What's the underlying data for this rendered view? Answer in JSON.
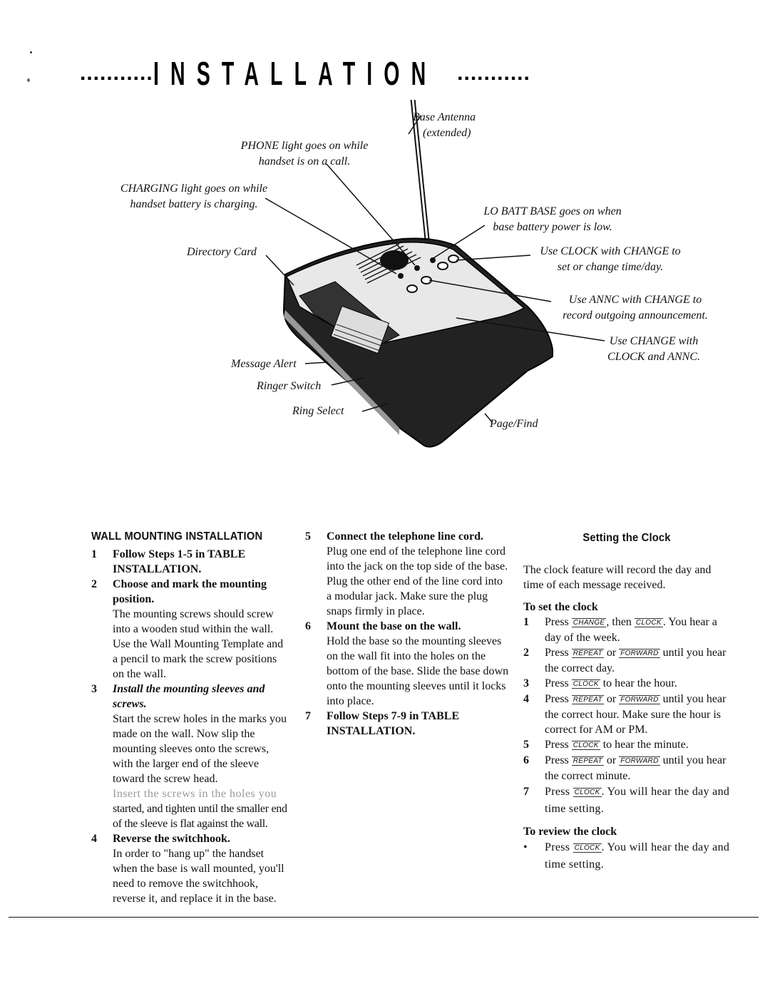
{
  "header": {
    "dots_left": "...........",
    "title": "INSTALLATION",
    "dots_right": "..........."
  },
  "illustration": {
    "callouts": {
      "base_antenna": "Base Antenna",
      "base_antenna_sub": "(extended)",
      "phone_light": "PHONE light goes on while",
      "phone_light_sub": "handset is on a call.",
      "charging_light": "CHARGING light goes on while",
      "charging_light_sub": "handset battery is charging.",
      "lo_batt": "LO BATT BASE goes on when",
      "lo_batt_sub": "base battery power is low.",
      "directory_card": "Directory Card",
      "clock": "Use CLOCK with CHANGE to",
      "clock_sub": "set or change time/day.",
      "annc": "Use ANNC with CHANGE to",
      "annc_sub": "record outgoing announcement.",
      "change": "Use CHANGE with",
      "change_sub": "CLOCK and ANNC.",
      "message_alert": "Message Alert",
      "ringer_switch": "Ringer Switch",
      "ring_select": "Ring Select",
      "page_find": "Page/Find"
    }
  },
  "wall_mounting": {
    "heading": "WALL MOUNTING INSTALLATION",
    "steps": [
      {
        "num": "1",
        "lead": "Follow Steps 1-5 in TABLE INSTALLATION.",
        "text": ""
      },
      {
        "num": "2",
        "lead": "Choose and mark the mounting position.",
        "text": "The mounting screws should screw into a wooden stud within the wall. Use the Wall Mounting Template and a pencil to mark the screw positions on the wall."
      },
      {
        "num": "3",
        "lead": "Install the mounting sleeves and screws.",
        "text": "Start the screw holes in the marks you made on the wall. Now slip the mounting sleeves onto the screws, with the larger end of the sleeve toward the screw head.",
        "faded": "Insert the screws in the holes you",
        "text2": "started, and tighten until the smaller end of the sleeve is flat against the wall."
      },
      {
        "num": "4",
        "lead": "Reverse the switchhook.",
        "text": "In order to \"hang up\" the handset when the base is wall mounted, you'll need to remove the switchhook, reverse it, and replace it in the base."
      },
      {
        "num": "5",
        "lead": "Connect the telephone line cord.",
        "text": "Plug one end of the telephone line cord into the jack on the top side of the base. Plug the other end of the line cord into a modular jack. Make sure the plug snaps firmly in place."
      },
      {
        "num": "6",
        "lead": "Mount the base on the wall.",
        "text": "Hold the base so the mounting sleeves on the wall fit into the holes on the bottom of the base. Slide the base down onto the mounting sleeves until it locks into place."
      },
      {
        "num": "7",
        "lead": "Follow Steps 7-9 in TABLE INSTALLATION.",
        "text": ""
      }
    ]
  },
  "clock": {
    "heading": "Setting the Clock",
    "intro": "The clock feature will record the day and time of each message received.",
    "set_heading": "To set the clock",
    "keys": {
      "change": "CHANGE",
      "clock": "CLOCK",
      "repeat": "REPEAT",
      "forward": "FORWARD"
    },
    "set_steps": [
      {
        "num": "1",
        "pre": "Press",
        "mid": ", then",
        "post": ". You hear a day of the week."
      },
      {
        "num": "2",
        "pre": "Press",
        "mid": "or",
        "post": "until you hear the correct day."
      },
      {
        "num": "3",
        "pre": "Press",
        "post": "to hear the hour."
      },
      {
        "num": "4",
        "pre": "Press",
        "mid": "or",
        "post": "until you hear the correct hour. Make sure the hour is correct for AM or PM."
      },
      {
        "num": "5",
        "pre": "Press",
        "post": "to hear the minute."
      },
      {
        "num": "6",
        "pre": "Press",
        "mid": "or",
        "post": "until you hear the correct minute."
      },
      {
        "num": "7",
        "pre": "Press",
        "post": ". You will hear the day and time setting."
      }
    ],
    "review_heading": "To review the clock",
    "review_bullet": "•",
    "review_step": {
      "pre": "Press",
      "post": ". You will hear the day and time setting."
    }
  }
}
